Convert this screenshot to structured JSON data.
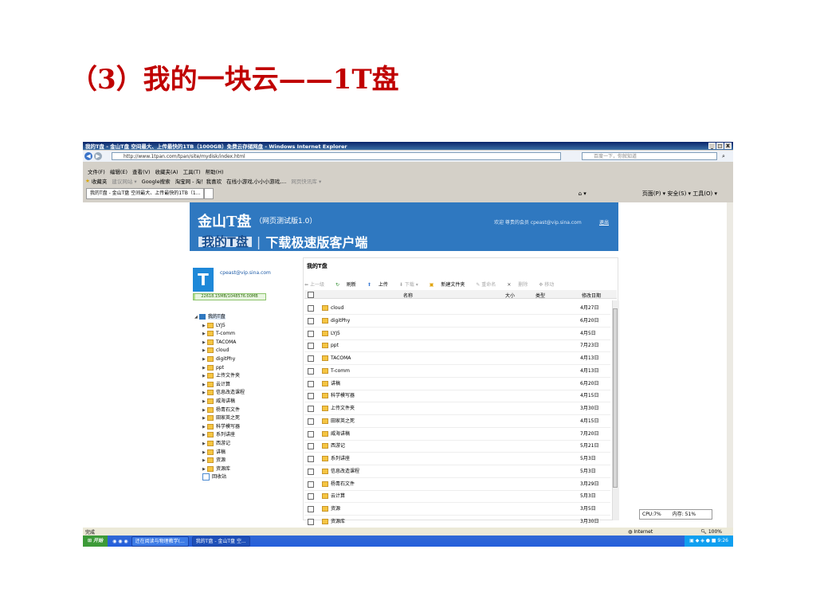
{
  "slide": {
    "title": "（3）我的一块云——1T盘"
  },
  "window": {
    "title": "我的T盘 - 金山T盘 空间最大、上传最快的1TB（1000GB）免费云存储网盘 - Windows Internet Explorer",
    "controls": [
      "_",
      "□",
      "X"
    ]
  },
  "browser": {
    "address": "http://www.1tpan.com/tpan/site/mydisk/index.html",
    "search_placeholder": "百度一下，你就知道",
    "menu": [
      "文件(F)",
      "编辑(E)",
      "查看(V)",
      "收藏夹(A)",
      "工具(T)",
      "帮助(H)"
    ],
    "favorites": [
      "收藏夹",
      "建议网站 ▾",
      "Google搜索",
      "淘宝网 - 淘！我喜欢",
      "在线小游戏,小小小游戏,...",
      "网页快讯库 ▾"
    ],
    "tab_label": "我的T盘 - 金山T盘 空间最大、上传最快的1TB（1...",
    "command_bar": "页面(P) ▾  安全(S) ▾  工具(O) ▾"
  },
  "app": {
    "logo": "金山T盘",
    "edition": "（网页测试版1.0）",
    "welcome": "欢迎 尊贵的会员  cpeast@vip.sina.com",
    "logout": "退出",
    "nav_tab": "我的T盘",
    "nav_sep": "|",
    "nav_download": "下载极速版客户端",
    "user_email": "cpeast@vip.sina.com",
    "avatar_letter": "T",
    "quota_text": "22618.15MB/1048576.00MB",
    "quota_fraction": 0.0216,
    "tree_root": "我的T盘",
    "tree": [
      "LYJ5",
      "T-comm",
      "TACOMA",
      "cloud",
      "digitPhy",
      "ppt",
      "上传文件夹",
      "云计算",
      "信息改造课程",
      "威海讲稿",
      "杨青石文件",
      "田家英之死",
      "科学模写器",
      "系列讲座",
      "西游记",
      "讲稿",
      "资源",
      "资源库"
    ],
    "recycle": "回收站",
    "panel_title": "我的T盘",
    "toolbar": {
      "up": "上一级",
      "refresh": "刷新",
      "upload": "上传",
      "download": "下载 ▾",
      "new_folder": "新建文件夹",
      "rename": "重命名",
      "delete": "删除",
      "move": "移动"
    },
    "columns": {
      "name": "名称",
      "size": "大小",
      "type": "类型",
      "date": "修改日期"
    },
    "files": [
      {
        "name": "cloud",
        "date": "4月27日"
      },
      {
        "name": "digitPhy",
        "date": "6月20日"
      },
      {
        "name": "LYJ5",
        "date": "4月5日"
      },
      {
        "name": "ppt",
        "date": "7月23日"
      },
      {
        "name": "TACOMA",
        "date": "4月13日"
      },
      {
        "name": "T-comm",
        "date": "4月13日"
      },
      {
        "name": "讲稿",
        "date": "6月20日"
      },
      {
        "name": "科学模写器",
        "date": "4月15日"
      },
      {
        "name": "上传文件夹",
        "date": "3月30日"
      },
      {
        "name": "田家英之死",
        "date": "4月15日"
      },
      {
        "name": "威海讲稿",
        "date": "7月20日"
      },
      {
        "name": "西游记",
        "date": "5月21日"
      },
      {
        "name": "系列讲座",
        "date": "5月3日"
      },
      {
        "name": "信息改造课程",
        "date": "5月3日"
      },
      {
        "name": "杨青石文件",
        "date": "3月29日"
      },
      {
        "name": "云计算",
        "date": "5月3日"
      },
      {
        "name": "资源",
        "date": "3月5日"
      },
      {
        "name": "资源库",
        "date": "3月30日"
      }
    ]
  },
  "status": {
    "left": "完成",
    "zone": "Internet",
    "zoom": "100%",
    "cpu": "CPU:7%",
    "memory": "内存: 51%"
  },
  "taskbar": {
    "start": "开始",
    "tasks": [
      "还在阅读与物理教学(...",
      "我的T盘 - 金山T盘 空..."
    ],
    "clock": "9:26"
  }
}
